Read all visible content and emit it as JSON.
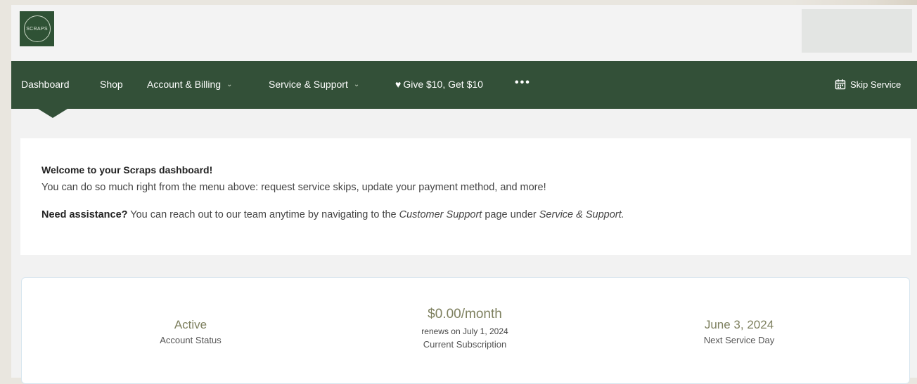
{
  "brand": {
    "logo_text": "SCRAPS",
    "accent": "#335038"
  },
  "nav": {
    "items": [
      {
        "label": "Dashboard",
        "active": true
      },
      {
        "label": "Shop"
      },
      {
        "label": "Account & Billing",
        "dropdown": true
      },
      {
        "label": "Service & Support",
        "dropdown": true
      },
      {
        "label": "Give $10, Get $10",
        "icon": "heart-icon"
      }
    ],
    "more_label": "•••",
    "skip_label": "Skip Service",
    "skip_icon": "calendar-icon"
  },
  "welcome": {
    "title": "Welcome to your Scraps dashboard!",
    "line1": "You can do so much right from the menu above: request service skips, update your payment method, and more!",
    "line2_bold": "Need assistance?",
    "line2_a": " You can reach out to our team anytime by navigating to the ",
    "line2_italic1": "Customer Support",
    "line2_b": " page under ",
    "line2_italic2": "Service & Support."
  },
  "stats": {
    "status_value": "Active",
    "status_label": "Account Status",
    "subscription_value": "$0.00/month",
    "subscription_renew": "renews on July 1, 2024",
    "subscription_label": "Current Subscription",
    "next_value": "June 3, 2024",
    "next_label": "Next Service Day"
  }
}
